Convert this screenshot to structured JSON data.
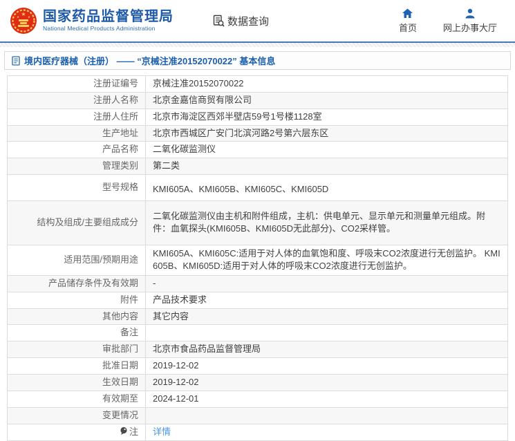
{
  "header": {
    "logo": {
      "title_zh": "国家药品监督管理局",
      "title_en": "National Medical Products Administration"
    },
    "data_query_label": "数据查询",
    "nav": [
      {
        "label": "首页",
        "icon": "home-icon"
      },
      {
        "label": "网上办事大厅",
        "icon": "person-icon"
      }
    ]
  },
  "breadcrumb": {
    "text": "境内医疗器械（注册） —— “京械注准20152070022” 基本信息"
  },
  "table": {
    "rows": [
      {
        "label": "注册证编号",
        "value": "京械注准20152070022"
      },
      {
        "label": "注册人名称",
        "value": "北京金嘉信商贸有限公司"
      },
      {
        "label": "注册人住所",
        "value": "北京市海淀区西郊半壁店59号1号楼1128室"
      },
      {
        "label": "生产地址",
        "value": "北京市西城区广安门北滨河路2号第六层东区"
      },
      {
        "label": "产品名称",
        "value": "二氧化碳监测仪"
      },
      {
        "label": "管理类别",
        "value": "第二类"
      },
      {
        "label": "型号规格",
        "value": "KMI605A、KMI605B、KMI605C、KMI605D"
      },
      {
        "label": "结构及组成/主要组成成分",
        "value": "二氧化碳监测仪由主机和附件组成，主机：供电单元、显示单元和测量单元组成。附件：血氧探头(KMI605B、KMI605D无此部分)、CO2采样管。"
      },
      {
        "label": "适用范围/预期用途",
        "value": "KMI605A、KMI605C:适用于对人体的血氧饱和度、呼吸末CO2浓度进行无创监护。 KMI605B、KMI605D:适用于对人体的呼吸末CO2浓度进行无创监护。"
      },
      {
        "label": "产品储存条件及有效期",
        "value": "-"
      },
      {
        "label": "附件",
        "value": "产品技术要求"
      },
      {
        "label": "其他内容",
        "value": "其它内容"
      },
      {
        "label": "备注",
        "value": ""
      },
      {
        "label": "审批部门",
        "value": "北京市食品药品监督管理局"
      },
      {
        "label": "批准日期",
        "value": "2019-12-02"
      },
      {
        "label": "生效日期",
        "value": "2019-12-02"
      },
      {
        "label": "有效期至",
        "value": "2024-12-01"
      },
      {
        "label": "变更情况",
        "value": ""
      },
      {
        "label": "注",
        "value": "详情",
        "label_icon": "note-icon",
        "link": true
      }
    ]
  },
  "colors": {
    "brand_blue": "#1e5aa7",
    "icon_blue": "#2062b4",
    "emblem_red": "#e02b16",
    "emblem_gold": "#f5ce58",
    "link_blue": "#4a96e8",
    "alt_row": "#f7f7f7"
  }
}
